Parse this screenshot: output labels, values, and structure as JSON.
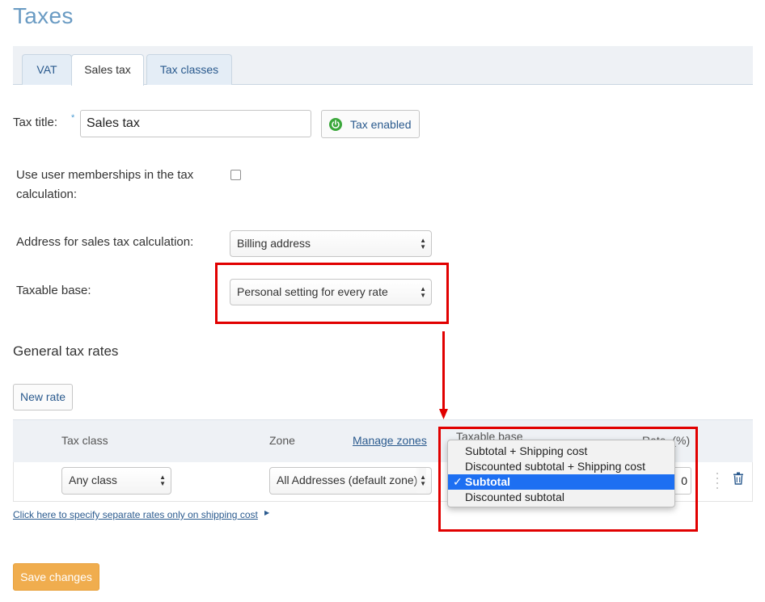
{
  "page": {
    "title": "Taxes"
  },
  "tabs": [
    {
      "label": "VAT"
    },
    {
      "label": "Sales tax"
    },
    {
      "label": "Tax classes"
    }
  ],
  "form": {
    "tax_title_label": "Tax title:",
    "required_mark": "*",
    "tax_title_value": "Sales tax",
    "tax_enabled_label": "Tax enabled",
    "memberships_label_line1": "Use user memberships in the tax",
    "memberships_label_line2": "calculation:",
    "address_label": "Address for sales tax calculation:",
    "address_value": "Billing address",
    "taxable_base_label": "Taxable base:",
    "taxable_base_value": "Personal setting for every rate"
  },
  "rates": {
    "section_title": "General tax rates",
    "new_rate_label": "New rate",
    "columns": {
      "tax_class": "Tax class",
      "zone": "Zone",
      "manage_zones": "Manage zones",
      "taxable_base": "Taxable base",
      "rate": "Rate, (%)"
    },
    "row": {
      "tax_class": "Any class",
      "zone": "All Addresses (default zone)",
      "rate_value": "0"
    },
    "dropdown_options": [
      {
        "label": "Subtotal + Shipping cost",
        "selected": false
      },
      {
        "label": "Discounted subtotal + Shipping cost",
        "selected": false
      },
      {
        "label": "Subtotal",
        "selected": true
      },
      {
        "label": "Discounted subtotal",
        "selected": false
      }
    ],
    "shipping_link": "Click here to specify separate rates only on shipping cost"
  },
  "actions": {
    "save_label": "Save changes"
  },
  "colors": {
    "accent": "#6a9bc3",
    "link": "#2a5a8e",
    "save": "#f0ad4e",
    "highlight": "#e10000",
    "enabled": "#3aa73a",
    "menu_selected": "#1d6ff2"
  }
}
